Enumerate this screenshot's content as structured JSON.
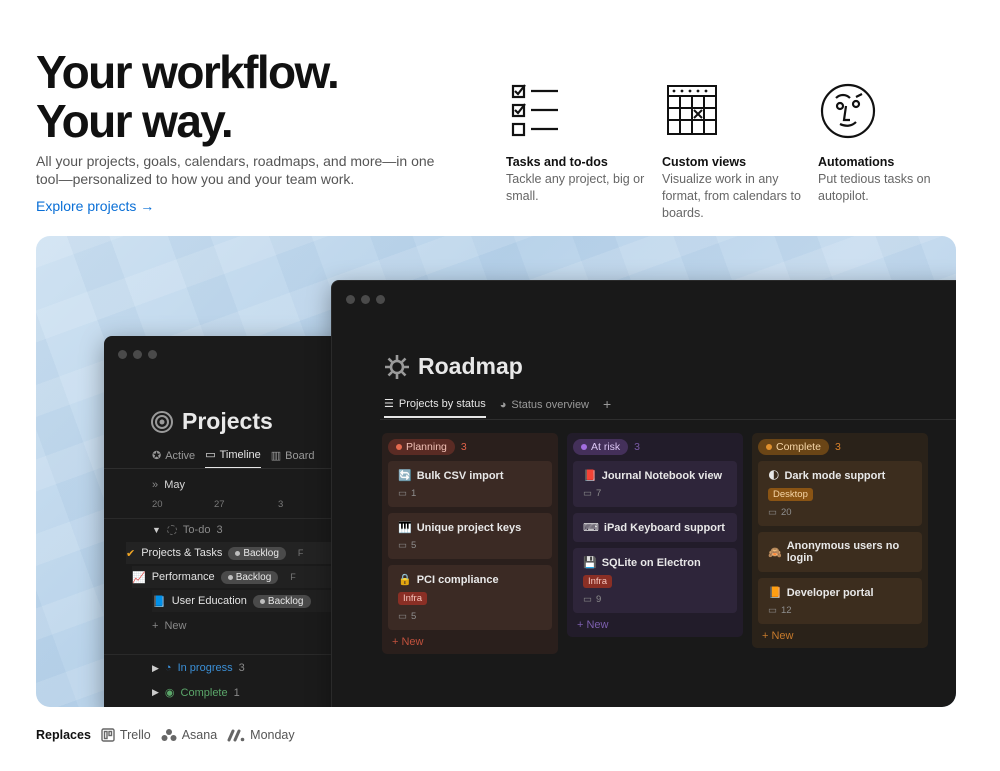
{
  "hero": {
    "title_line1": "Your workflow.",
    "title_line2": "Your way.",
    "subtitle": "All your projects, goals, calendars, roadmaps, and more—in one tool—personalized to how you and your team work.",
    "link": "Explore projects →"
  },
  "features": [
    {
      "icon": "checklist-icon",
      "title": "Tasks and to-dos",
      "desc": "Tackle any project, big or small."
    },
    {
      "icon": "calendar-icon",
      "title": "Custom views",
      "desc": "Visualize work in any format, from calendars to boards."
    },
    {
      "icon": "robot-face-icon",
      "title": "Automations",
      "desc": "Put tedious tasks on autopilot."
    }
  ],
  "projects_window": {
    "title": "Projects",
    "tabs": [
      "Active",
      "Timeline",
      "Board"
    ],
    "month": "May",
    "days": [
      "20",
      "27",
      "3"
    ],
    "group_todo": {
      "label": "To-do",
      "count": "3"
    },
    "rows": [
      {
        "name": "Projects & Tasks",
        "badge": "Backlog",
        "trail": "F"
      },
      {
        "name": "Performance",
        "badge": "Backlog",
        "trail": "F"
      },
      {
        "name": "User Education",
        "badge": "Backlog",
        "trail": ""
      }
    ],
    "new_label": "New",
    "group_inprogress": {
      "label": "In progress",
      "count": "3"
    },
    "group_complete": {
      "label": "Complete",
      "count": "1"
    }
  },
  "roadmap_window": {
    "title": "Roadmap",
    "tabs": [
      "Projects by status",
      "Status overview"
    ],
    "add_tab": "+",
    "columns": [
      {
        "label": "Planning",
        "count": "3",
        "new_label": "New",
        "colors": {
          "bg": "#2a1f1c",
          "card": "#3b2a24",
          "pill": "#5a2b24",
          "pilltext": "#f2c1b6",
          "dot": "#e56a4f",
          "accent": "#e0624a"
        },
        "cards": [
          {
            "icon": "🔄",
            "title": "Bulk CSV import",
            "comments": "1",
            "tag": ""
          },
          {
            "icon": "🎹",
            "title": "Unique project keys",
            "comments": "5",
            "tag": ""
          },
          {
            "icon": "🔒",
            "title": "PCI compliance",
            "comments": "5",
            "tag": "Infra"
          }
        ]
      },
      {
        "label": "At risk",
        "count": "3",
        "new_label": "New",
        "colors": {
          "bg": "#221c2a",
          "card": "#2e253a",
          "pill": "#44305a",
          "pilltext": "#dcc6f5",
          "dot": "#a36ee0",
          "accent": "#9a6fd6"
        },
        "cards": [
          {
            "icon": "📕",
            "title": "Journal Notebook view",
            "comments": "7",
            "tag": ""
          },
          {
            "icon": "⌨",
            "title": "iPad Keyboard support",
            "comments": "",
            "tag": ""
          },
          {
            "icon": "💾",
            "title": "SQLite on Electron",
            "comments": "9",
            "tag": "Infra"
          }
        ]
      },
      {
        "label": "Complete",
        "count": "3",
        "new_label": "New",
        "colors": {
          "bg": "#2a2219",
          "card": "#3c2d1e",
          "pill": "#6a4516",
          "pilltext": "#f6d6a8",
          "dot": "#e0902d",
          "accent": "#d9822b"
        },
        "cards": [
          {
            "icon": "🌓",
            "title": "Dark mode support",
            "comments": "20",
            "tag": "Desktop"
          },
          {
            "icon": "🙈",
            "title": "Anonymous users no login",
            "comments": "",
            "tag": ""
          },
          {
            "icon": "📙",
            "title": "Developer portal",
            "comments": "12",
            "tag": ""
          }
        ]
      }
    ]
  },
  "replaces": {
    "label": "Replaces",
    "items": [
      {
        "icon": "trello-icon",
        "name": "Trello"
      },
      {
        "icon": "asana-icon",
        "name": "Asana"
      },
      {
        "icon": "monday-icon",
        "name": "Monday"
      }
    ]
  }
}
